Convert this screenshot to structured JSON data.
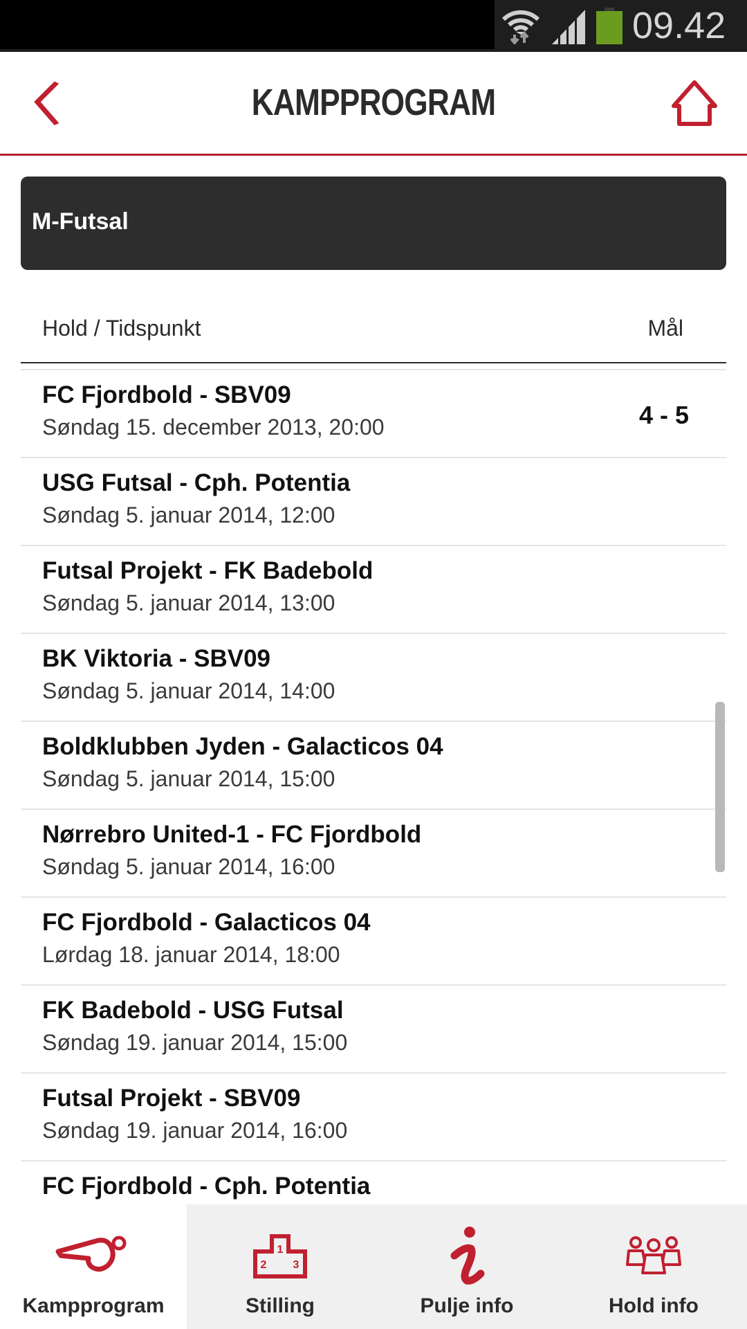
{
  "status_bar": {
    "time": "09.42",
    "icons": [
      "wifi-icon",
      "signal-icon",
      "battery-icon"
    ],
    "battery_color": "#6b9c1f"
  },
  "header": {
    "title": "KAMPPROGRAM",
    "back_icon": "chevron-left-icon",
    "home_icon": "home-icon",
    "accent_color": "#c0202f"
  },
  "section": {
    "title": "M-Futsal"
  },
  "table": {
    "columns": {
      "left": "Hold / Tidspunkt",
      "right": "Mål"
    },
    "rows": [
      {
        "teams": "FC Fjordbold - SBV09",
        "when": "Søndag 15. december 2013, 20:00",
        "score": "4 - 5"
      },
      {
        "teams": "USG Futsal - Cph. Potentia",
        "when": "Søndag 5. januar 2014, 12:00",
        "score": ""
      },
      {
        "teams": "Futsal Projekt - FK Badebold",
        "when": "Søndag 5. januar 2014, 13:00",
        "score": ""
      },
      {
        "teams": "BK Viktoria - SBV09",
        "when": "Søndag 5. januar 2014, 14:00",
        "score": ""
      },
      {
        "teams": "Boldklubben Jyden - Galacticos 04",
        "when": "Søndag 5. januar 2014, 15:00",
        "score": ""
      },
      {
        "teams": "Nørrebro United-1 - FC Fjordbold",
        "when": "Søndag 5. januar 2014, 16:00",
        "score": ""
      },
      {
        "teams": "FC Fjordbold - Galacticos 04",
        "when": "Lørdag 18. januar 2014, 18:00",
        "score": ""
      },
      {
        "teams": "FK Badebold - USG Futsal",
        "when": "Søndag 19. januar 2014, 15:00",
        "score": ""
      },
      {
        "teams": "Futsal Projekt - SBV09",
        "when": "Søndag 19. januar 2014, 16:00",
        "score": ""
      },
      {
        "teams": "FC Fjordbold - Cph. Potentia",
        "when": "",
        "score": ""
      }
    ]
  },
  "bottom_nav": {
    "items": [
      {
        "label": "Kampprogram",
        "icon": "whistle-icon",
        "active": true
      },
      {
        "label": "Stilling",
        "icon": "podium-icon",
        "active": false
      },
      {
        "label": "Pulje info",
        "icon": "info-icon",
        "active": false
      },
      {
        "label": "Hold info",
        "icon": "team-icon",
        "active": false
      }
    ]
  }
}
